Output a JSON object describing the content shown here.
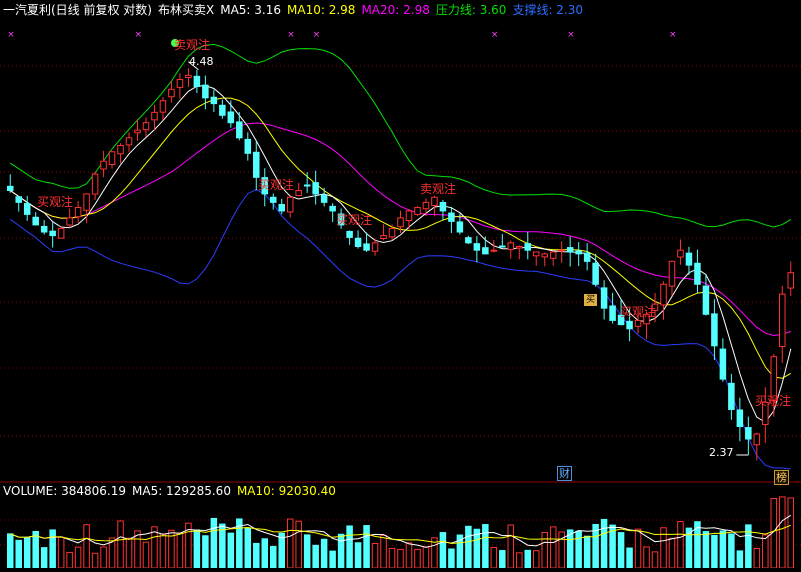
{
  "price_panel": {
    "title": "一汽夏利(日线 前复权 对数)",
    "indicator_name": "布林买卖X",
    "ma5_label": "MA5: 3.16",
    "ma10_label": "MA10: 2.98",
    "ma20_label": "MA20: 2.98",
    "pressure_label": "压力线: 3.60",
    "support_label": "支撑线: 2.30",
    "high_note": "4.48",
    "low_note": "2.37",
    "signal_labels": [
      "卖观注",
      "买观注",
      "买观注",
      "买观注",
      "卖观注",
      "买观注",
      "买观注"
    ],
    "badge_cai": "财",
    "badge_mai": "买",
    "badge_bang": "榜"
  },
  "volume_panel": {
    "volume_label": "VOLUME: 384806.19",
    "ma5_label": "MA5: 129285.60",
    "ma10_label": "MA10: 92030.40"
  },
  "colors": {
    "background": "#000000",
    "up": "#ff3232",
    "down": "#54ffff",
    "ma5": "#ffffff",
    "ma10": "#ffff00",
    "ma20": "#ff00ff",
    "pressure": "#00e000",
    "support": "#2c3cff",
    "grid": "#8b0000",
    "marker": "#ff44ff"
  },
  "chart_data": {
    "type": "candlestick",
    "title": "一汽夏利(日线 前复权 对数)",
    "y_high_marked": 4.48,
    "y_low_marked": 2.37,
    "ylim": [
      2.25,
      4.8
    ],
    "series": [
      {
        "name": "MA5",
        "last": 3.16
      },
      {
        "name": "MA10",
        "last": 2.98
      },
      {
        "name": "MA20",
        "last": 2.98
      },
      {
        "name": "压力线",
        "last": 3.6
      },
      {
        "name": "支撑线",
        "last": 2.3
      }
    ],
    "close": [
      3.62,
      3.55,
      3.48,
      3.42,
      3.38,
      3.36,
      3.4,
      3.46,
      3.52,
      3.6,
      3.72,
      3.8,
      3.86,
      3.9,
      3.95,
      4.0,
      4.05,
      4.12,
      4.2,
      4.28,
      4.35,
      4.38,
      4.3,
      4.22,
      4.18,
      4.1,
      4.05,
      3.95,
      3.85,
      3.7,
      3.6,
      3.55,
      3.5,
      3.58,
      3.62,
      3.65,
      3.6,
      3.55,
      3.5,
      3.42,
      3.35,
      3.3,
      3.28,
      3.32,
      3.36,
      3.4,
      3.46,
      3.5,
      3.52,
      3.55,
      3.58,
      3.5,
      3.44,
      3.38,
      3.32,
      3.28,
      3.26,
      3.28,
      3.3,
      3.32,
      3.3,
      3.28,
      3.27,
      3.26,
      3.27,
      3.28,
      3.27,
      3.26,
      3.22,
      3.1,
      2.98,
      2.92,
      2.9,
      2.88,
      2.92,
      2.95,
      3.0,
      3.1,
      3.22,
      3.28,
      3.2,
      3.1,
      2.95,
      2.8,
      2.65,
      2.52,
      2.45,
      2.4,
      2.42,
      2.55,
      2.75,
      3.05,
      3.16
    ],
    "volume": {
      "last": 384806.19,
      "ma5": 129285.6,
      "ma10": 92030.4
    }
  }
}
